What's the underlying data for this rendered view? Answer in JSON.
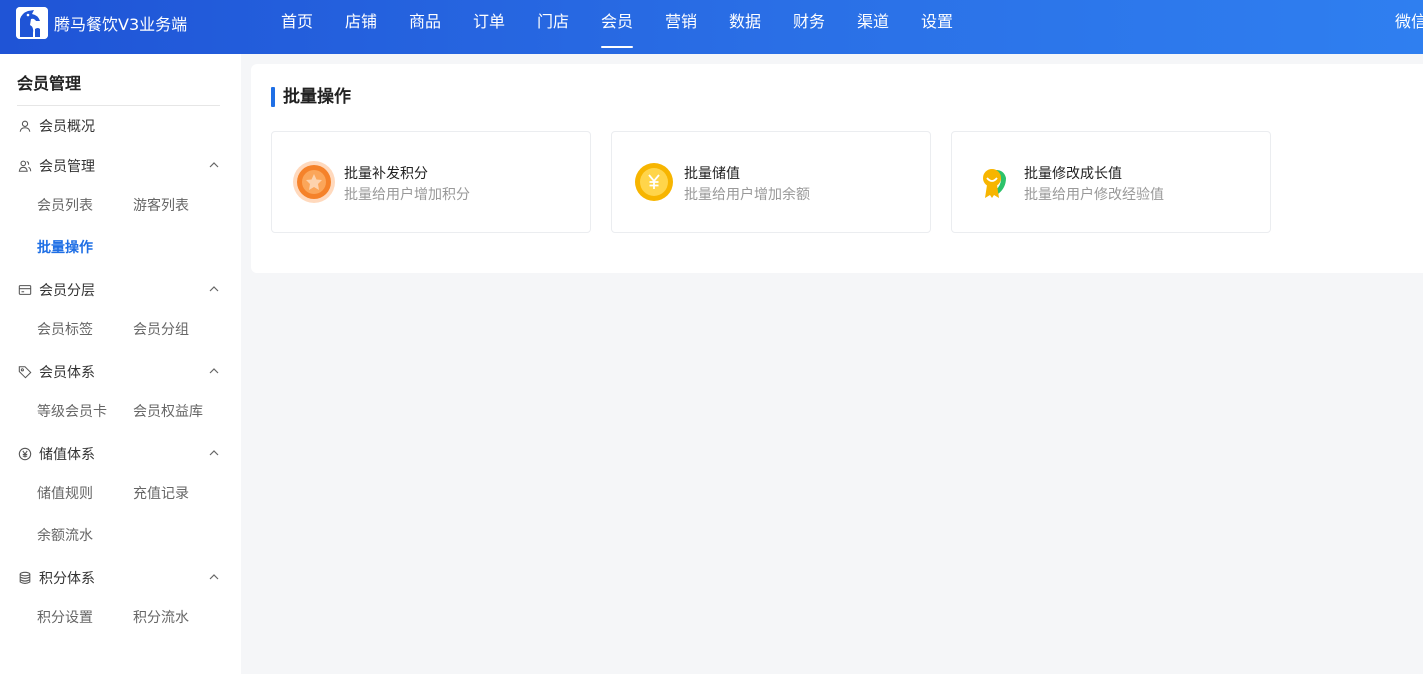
{
  "app": {
    "brand_name": "腾马餐饮V3业务端",
    "logo_icon": "horse-logo-icon"
  },
  "nav": {
    "items": [
      "首页",
      "店铺",
      "商品",
      "订单",
      "门店",
      "会员",
      "营销",
      "数据",
      "财务",
      "渠道",
      "设置"
    ],
    "active_index": 5,
    "right_text": "微信"
  },
  "sidebar": {
    "title": "会员管理",
    "overview": "会员概况",
    "groups": [
      {
        "label": "会员管理",
        "icon": "users-icon",
        "items": [
          "会员列表",
          "游客列表",
          "批量操作"
        ]
      },
      {
        "label": "会员分层",
        "icon": "card-icon",
        "items": [
          "会员标签",
          "会员分组"
        ]
      },
      {
        "label": "会员体系",
        "icon": "tag-icon",
        "items": [
          "等级会员卡",
          "会员权益库"
        ]
      },
      {
        "label": "储值体系",
        "icon": "yen-icon",
        "items": [
          "储值规则",
          "充值记录",
          "余额流水"
        ]
      },
      {
        "label": "积分体系",
        "icon": "database-icon",
        "items": [
          "积分设置",
          "积分流水"
        ]
      }
    ],
    "active_item": "批量操作"
  },
  "main": {
    "title": "批量操作",
    "cards": [
      {
        "title": "批量补发积分",
        "desc": "批量给用户增加积分",
        "icon": "points-coin-icon",
        "color": "#f5822a"
      },
      {
        "title": "批量储值",
        "desc": "批量给用户增加余额",
        "icon": "yen-coin-icon",
        "color": "#f7b500"
      },
      {
        "title": "批量修改成长值",
        "desc": "批量给用户修改经验值",
        "icon": "growth-medal-icon",
        "color": "#2cc26a"
      }
    ]
  },
  "colors": {
    "header_start": "#1f54d6",
    "header_end": "#2f7ff0",
    "accent": "#1f6fe5"
  }
}
